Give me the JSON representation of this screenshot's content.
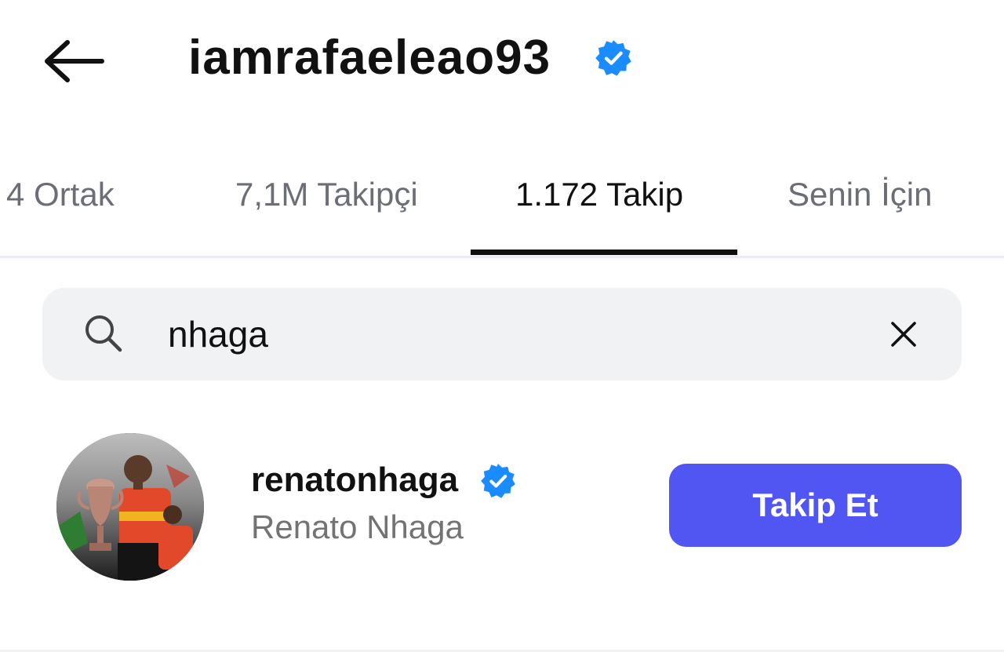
{
  "header": {
    "username": "iamrafaeleao93",
    "verified": true,
    "back_icon": "arrow-left-icon",
    "badge_color": "#1a8cff"
  },
  "tabs": [
    {
      "label": "4 Ortak",
      "active": false
    },
    {
      "label": "7,1M Takipçi",
      "active": false
    },
    {
      "label": "1.172 Takip",
      "active": true
    },
    {
      "label": "Senin İçin",
      "active": false
    }
  ],
  "search": {
    "value": "nhaga",
    "search_icon": "search-icon",
    "clear_icon": "close-icon"
  },
  "results": [
    {
      "username": "renatonhaga",
      "full_name": "Renato Nhaga",
      "verified": true,
      "follow_label": "Takip Et"
    }
  ],
  "colors": {
    "accent": "#5155f2",
    "verified_badge": "#1a8cff",
    "secondary_text": "#737373"
  }
}
